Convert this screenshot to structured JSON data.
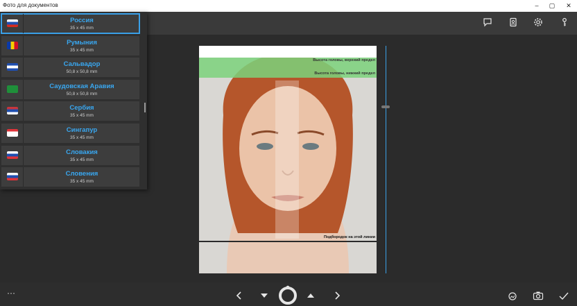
{
  "window": {
    "title": "Фото для документов"
  },
  "window_controls": {
    "minimize": "–",
    "maximize": "▢",
    "close": "✕"
  },
  "toolbar_icons": [
    "chat-icon",
    "id-card-icon",
    "gear-icon",
    "key-icon"
  ],
  "countries": [
    {
      "name": "Россия",
      "size": "35 x 45 mm",
      "flag": [
        "#ffffff",
        "#1f4fb0",
        "#d52b1e"
      ],
      "selected": true
    },
    {
      "name": "Румыния",
      "size": "35 x 45 mm",
      "flag_v": [
        "#0b3aa8",
        "#f5d000",
        "#ce1126"
      ]
    },
    {
      "name": "Сальвадор",
      "size": "50,8 x 50,8 mm",
      "flag": [
        "#1f4fb0",
        "#ffffff",
        "#1f4fb0"
      ]
    },
    {
      "name": "Саудовская Аравия",
      "size": "50,8 x 50,8 mm",
      "flag": [
        "#1f8f3a",
        "#1f8f3a",
        "#1f8f3a"
      ]
    },
    {
      "name": "Сербия",
      "size": "35 x 45 mm",
      "flag": [
        "#c6363c",
        "#1f4fb0",
        "#ffffff"
      ]
    },
    {
      "name": "Сингапур",
      "size": "35 x 45 mm",
      "flag": [
        "#e0343a",
        "#ffffff",
        "#ffffff"
      ]
    },
    {
      "name": "Словакия",
      "size": "35 x 45 mm",
      "flag": [
        "#ffffff",
        "#1f4fb0",
        "#e0343a"
      ]
    },
    {
      "name": "Словения",
      "size": "35 x 45 mm",
      "flag": [
        "#ffffff",
        "#1f4fb0",
        "#e0343a"
      ]
    }
  ],
  "photo": {
    "guide_top": "Высота головы, верхний предел",
    "guide_bottom": "Высота головы, нижний предел",
    "chin_label": "Подбородок на этой линии"
  },
  "bottom": {
    "more": "···"
  },
  "accent": "#39a7f0"
}
